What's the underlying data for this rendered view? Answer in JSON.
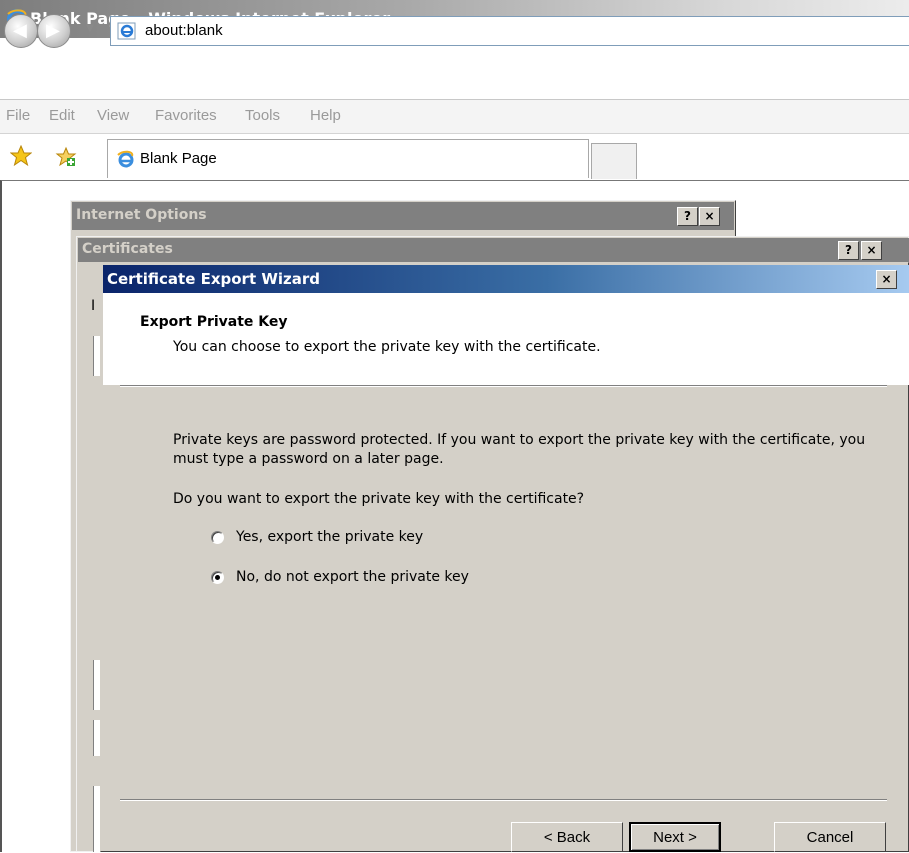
{
  "ie": {
    "title": "Blank Page - Windows Internet Explorer",
    "address": "about:blank",
    "menu": [
      "File",
      "Edit",
      "View",
      "Favorites",
      "Tools",
      "Help"
    ],
    "tab_label": "Blank Page"
  },
  "internet_options": {
    "title": "Internet Options",
    "help": "?",
    "close": "×"
  },
  "certificates": {
    "title": "Certificates",
    "help": "?",
    "close": "×",
    "peek_char": "I"
  },
  "wizard": {
    "title": "Certificate Export Wizard",
    "close": "×",
    "heading": "Export Private Key",
    "subheading": "You can choose to export the private key with the certificate.",
    "body": "Private keys are password protected. If you want to export the private key with the certificate, you must type a password on a later page.",
    "question": "Do you want to export the private key with the certificate?",
    "options": [
      {
        "label": "Yes, export the private key",
        "selected": false
      },
      {
        "label": "No, do not export the private key",
        "selected": true
      }
    ],
    "buttons": {
      "back": "< Back",
      "next": "Next >",
      "cancel": "Cancel"
    }
  },
  "colors": {
    "wizard_title_start": "#0a246a",
    "wizard_title_end": "#a6caf0",
    "dialog_face": "#d4d0c8",
    "inactive_title": "#808080"
  }
}
